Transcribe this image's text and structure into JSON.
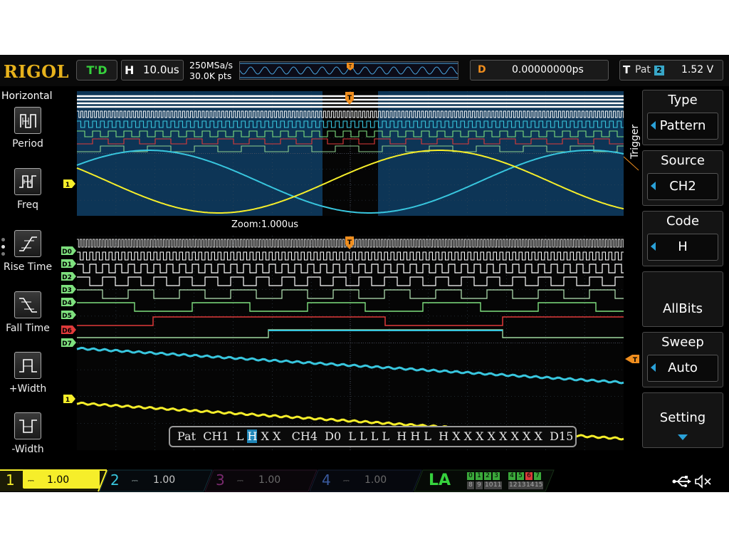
{
  "brand": "RIGOL",
  "status": {
    "run_state": "T'D"
  },
  "horizontal": {
    "label": "H",
    "timebase": "10.0us",
    "sample_rate": "250MSa/s",
    "memory_depth": "30.0K pts"
  },
  "delay": {
    "label": "D",
    "value": "0.00000000ps"
  },
  "trigger_status": {
    "label": "T",
    "mode": "Pat",
    "source": "2",
    "level": "1.52 V"
  },
  "left_menu": {
    "title": "Horizontal",
    "items": [
      {
        "label": "Period",
        "icon": "period-icon"
      },
      {
        "label": "Freq",
        "icon": "freq-icon"
      },
      {
        "label": "Rise Time",
        "icon": "rise-time-icon"
      },
      {
        "label": "Fall Time",
        "icon": "fall-time-icon"
      },
      {
        "label": "+Width",
        "icon": "pos-width-icon"
      },
      {
        "label": "-Width",
        "icon": "neg-width-icon"
      }
    ]
  },
  "right_menu": {
    "header": "Trigger",
    "type": {
      "title": "Type",
      "value": "Pattern"
    },
    "source": {
      "title": "Source",
      "value": "CH2"
    },
    "code": {
      "title": "Code",
      "value": "H"
    },
    "allbits": {
      "label": "AllBits"
    },
    "sweep": {
      "title": "Sweep",
      "value": "Auto"
    },
    "setting": {
      "label": "Setting"
    }
  },
  "zoom_label": "Zoom:1.000us",
  "digital_labels": [
    "D0",
    "D1",
    "D2",
    "D3",
    "D4",
    "D5",
    "D6",
    "D7"
  ],
  "channel_marker": "1",
  "trigger_marker": "T",
  "pattern_text": {
    "pre": "Pat  CH1  L ",
    "highlight": "H",
    "post": " X X   CH4  D0  L L L L  H H L  H X X X X X X X X  D15"
  },
  "channels": [
    {
      "num": "1",
      "scale": "1.00 V",
      "color": "#f6ee2a",
      "active": true
    },
    {
      "num": "2",
      "scale": "1.00 V",
      "color": "#38c6de",
      "active": false
    },
    {
      "num": "3",
      "scale": "1.00 V",
      "color": "#c83ab0",
      "active": false
    },
    {
      "num": "4",
      "scale": "1.00 V",
      "color": "#4a7fd8",
      "active": false
    }
  ],
  "la": {
    "label": "LA",
    "group1_top": [
      "0",
      "1",
      "2",
      "3"
    ],
    "group1_bot": [
      "8",
      "9",
      "10",
      "11"
    ],
    "group2_top": [
      "4",
      "5",
      "6",
      "7"
    ],
    "group2_bot": [
      "12",
      "13",
      "14",
      "15"
    ]
  },
  "colors": {
    "ch1": "#f6ee2a",
    "ch2": "#38c6de",
    "digital_green": "#7ee07e",
    "digital_red": "#e03a3a",
    "trigger_orange": "#f08e1e",
    "plot_bg": "#0d3556"
  }
}
